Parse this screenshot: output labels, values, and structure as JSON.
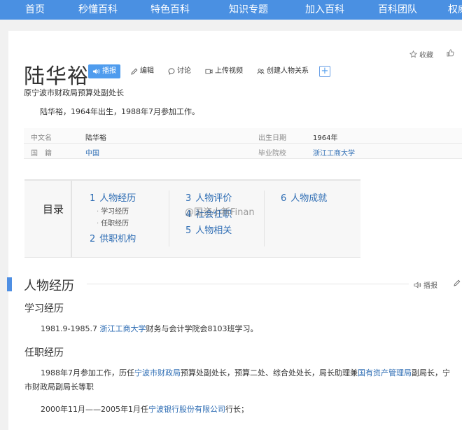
{
  "nav": [
    "首页",
    "秒懂百科",
    "特色百科",
    "知识专题",
    "加入百科",
    "百科团队",
    "权威"
  ],
  "entry": {
    "title": "陆华裕",
    "buttons": {
      "listen": "播报",
      "edit": "编辑",
      "discuss": "讨论",
      "upload_video": "上传视频",
      "create_relation": "创建人物关系",
      "plus": "+"
    },
    "favorite": "收藏",
    "subtitle": "原宁波市财政局预算处副处长",
    "summary": "陆华裕，1964年出生，1988年7月参加工作。"
  },
  "basic_info": [
    {
      "k1": "中文名",
      "v1": "陆华裕",
      "k2": "出生日期",
      "v2": "1964年"
    },
    {
      "k1": "国　籍",
      "v1": "中国",
      "k2": "毕业院校",
      "v2": "浙江工商大学"
    }
  ],
  "toc": {
    "title": "目录",
    "items": [
      {
        "num": "1",
        "label": "人物经历",
        "subs": [
          "学习经历",
          "任职经历"
        ]
      },
      {
        "num": "2",
        "label": "供职机构"
      },
      {
        "num": "3",
        "label": "人物评价"
      },
      {
        "num": "4",
        "label": "社会任职"
      },
      {
        "num": "5",
        "label": "人物相关"
      },
      {
        "num": "6",
        "label": "人物成就"
      }
    ]
  },
  "watermark": "@国资小新Finan",
  "section": {
    "title": "人物经历",
    "listen": "播报",
    "study": {
      "heading": "学习经历",
      "p1_pre": "1981.9-1985.7 ",
      "p1_link": "浙江工商大学",
      "p1_post": "财务与会计学院会8103班学习。"
    },
    "work": {
      "heading": "任职经历",
      "p2_a": "1988年7月参加工作，历任",
      "p2_link1": "宁波市财政局",
      "p2_b": "预算处副处长，预算二处、综合处处长，局长助理兼",
      "p2_link2": "国有资产管理局",
      "p2_c": "副局长，宁",
      "p2_line2": "市财政局副局长等职",
      "p3_a": "2000年11月——2005年1月任",
      "p3_link": "宁波银行股份有限公司",
      "p3_b": "行长；"
    }
  }
}
